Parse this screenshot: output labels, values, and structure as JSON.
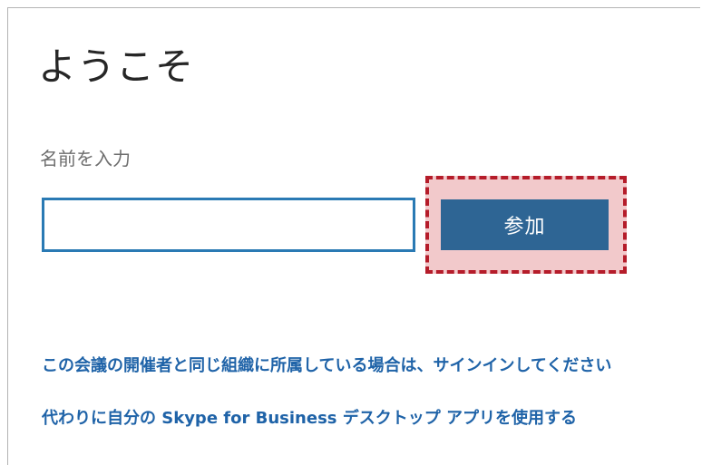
{
  "welcome": {
    "title": "ようこそ",
    "name_label": "名前を入力",
    "name_input_value": "",
    "join_button_label": "参加"
  },
  "links": {
    "sign_in": "この会議の開催者と同じ組織に所属している場合は、サインインしてください",
    "use_desktop_app": "代わりに自分の Skype for Business  デスクトップ アプリを使用する"
  },
  "colors": {
    "accent_blue": "#2e6594",
    "link_blue": "#1f63a8",
    "input_border": "#2a7ab4",
    "highlight_fill": "#f2c9cb",
    "highlight_border": "#b51c2a"
  }
}
